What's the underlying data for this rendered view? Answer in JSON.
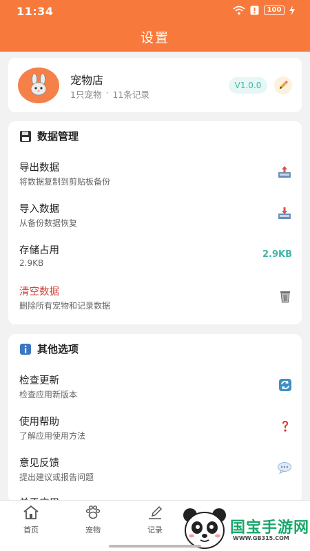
{
  "status_bar": {
    "time": "11:34",
    "battery": "100"
  },
  "header": {
    "title": "设置"
  },
  "profile": {
    "name": "宠物店",
    "pet_count": "1只宠物",
    "separator": "·",
    "record_count": "11条记录",
    "version": "V1.0.0"
  },
  "data_section": {
    "title": "数据管理",
    "items": [
      {
        "title": "导出数据",
        "subtitle": "将数据复制到剪贴板备份"
      },
      {
        "title": "导入数据",
        "subtitle": "从备份数据恢复"
      },
      {
        "title": "存储占用",
        "subtitle": "2.9KB",
        "value": "2.9KB"
      },
      {
        "title": "清空数据",
        "subtitle": "删除所有宠物和记录数据"
      }
    ]
  },
  "other_section": {
    "title": "其他选项",
    "items": [
      {
        "title": "检查更新",
        "subtitle": "检查应用新版本"
      },
      {
        "title": "使用帮助",
        "subtitle": "了解应用使用方法"
      },
      {
        "title": "意见反馈",
        "subtitle": "提出建议或报告问题"
      },
      {
        "title": "关于应用",
        "subtitle": ""
      }
    ]
  },
  "bottom_nav": [
    {
      "label": "首页"
    },
    {
      "label": "宠物"
    },
    {
      "label": "记录"
    }
  ],
  "watermark": {
    "text": "国宝手游网",
    "url": "WWW.GB315.COM"
  },
  "colors": {
    "primary": "#f77a3c",
    "teal": "#3fb5a6",
    "danger": "#d2453a",
    "background": "#f2f2f2"
  }
}
